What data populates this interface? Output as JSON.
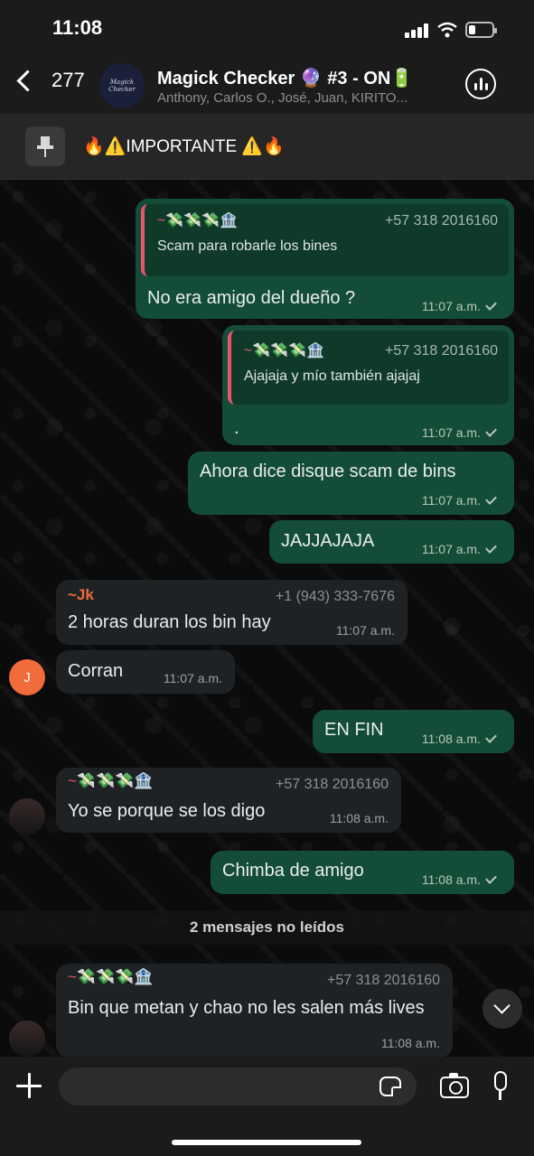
{
  "status": {
    "time": "11:08"
  },
  "header": {
    "back_count": "277",
    "avatar_text": "Magick Checker",
    "title": "Magick Checker 🔮 #3 - ON🔋",
    "subtitle": "Anthony, Carlos O., José, Juan, KIRITO..."
  },
  "pinned": {
    "text": "🔥⚠️IMPORTANTE ⚠️🔥"
  },
  "messages": [
    {
      "quote_name": "~💸💸💸🏦",
      "quote_phone": "+57 318 2016160",
      "quote_text": "Scam para robarle los bines",
      "text": "No era amigo del dueño ?",
      "time": "11:07 a.m."
    },
    {
      "quote_name": "~💸💸💸🏦",
      "quote_phone": "+57 318 2016160",
      "quote_text": "Ajajaja y mío también ajajaj",
      "text": ".",
      "time": "11:07 a.m."
    },
    {
      "text": "Ahora dice disque scam de bins",
      "time": "11:07 a.m."
    },
    {
      "text": "JAJJAJAJA",
      "time": "11:07 a.m."
    },
    {
      "sender": "~Jk",
      "phone": "+1 (943) 333-7676",
      "text": "2 horas duran los bin hay",
      "time": "11:07 a.m."
    },
    {
      "avatar": "J",
      "text": "Corran",
      "time": "11:07 a.m."
    },
    {
      "text": "EN FIN",
      "time": "11:08 a.m."
    },
    {
      "sender": "~💸💸💸🏦",
      "phone": "+57 318 2016160",
      "text": "Yo se porque se los digo",
      "time": "11:08 a.m."
    },
    {
      "text": "Chimba de amigo",
      "time": "11:08 a.m."
    },
    {
      "sender": "~💸💸💸🏦",
      "phone": "+57 318 2016160",
      "text": "Bin que metan y chao no les salen más lives",
      "time": "11:08 a.m."
    }
  ],
  "unread_divider": "2 mensajes no leídos",
  "input": {
    "placeholder": ""
  },
  "colors": {
    "outgoing": "#144d37",
    "incoming": "#1f2225",
    "quote_accent": "#e8546b",
    "jk_name": "#f26b3a",
    "avatar_j": "#f26b3a"
  }
}
